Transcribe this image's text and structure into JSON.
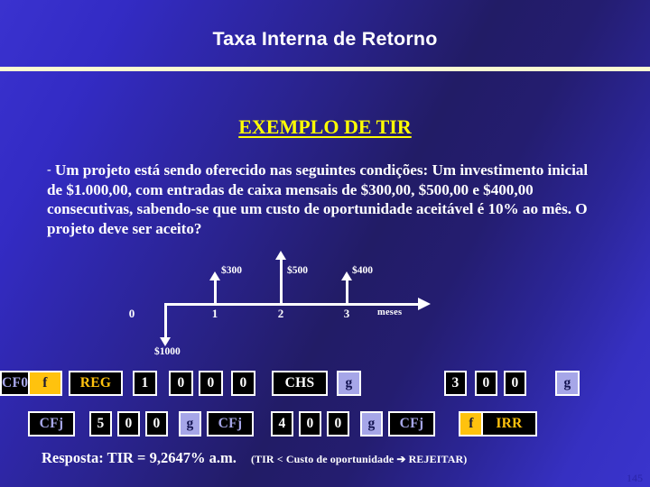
{
  "slide": {
    "title": "Taxa Interna de Retorno",
    "heading": "EXEMPLO DE TIR",
    "page_number": "145",
    "colors": {
      "background_light": "#3a34cd",
      "background_dark": "#221c66",
      "rule": "#fbfbd2",
      "heading": "#ffff00",
      "text": "#ffffff",
      "f_key_bg": "#ffc20e",
      "g_key_bg": "#a6a6e8",
      "key_bg": "#000000",
      "page_number": "#2a24a8"
    }
  },
  "problem": {
    "bullet": "-",
    "text": "Um projeto está sendo oferecido nas seguintes condições: Um investimento inicial de $1.000,00, com entradas de caixa mensais de $300,00, $500,00 e $400,00 consecutivas, sabendo-se que um custo de oportunidade aceitável é 10% ao mês. O projeto deve ser aceito?"
  },
  "timeline": {
    "axis_unit": "meses",
    "tick_labels": [
      "0",
      "1",
      "2",
      "3"
    ],
    "outflow": {
      "label": "$1000",
      "period": 0,
      "direction": "down",
      "amount": -1000
    },
    "inflows": [
      {
        "label": "$300",
        "period": 1,
        "direction": "up",
        "amount": 300
      },
      {
        "label": "$500",
        "period": 2,
        "direction": "up",
        "amount": 500
      },
      {
        "label": "$400",
        "period": 3,
        "direction": "up",
        "amount": 400
      }
    ]
  },
  "keypad": {
    "row1": [
      {
        "label": "f",
        "style": "f-key"
      },
      {
        "label": "REG",
        "style": "gold-text"
      },
      {
        "label": "1",
        "style": "plain"
      },
      {
        "label": "0",
        "style": "plain"
      },
      {
        "label": "0",
        "style": "plain"
      },
      {
        "label": "0",
        "style": "plain"
      },
      {
        "label": "CHS",
        "style": "plain"
      },
      {
        "label": "g",
        "style": "g-key"
      },
      {
        "label": "CF0",
        "style": "blue-text"
      },
      {
        "label": "3",
        "style": "plain"
      },
      {
        "label": "0",
        "style": "plain"
      },
      {
        "label": "0",
        "style": "plain"
      },
      {
        "label": "g",
        "style": "g-key"
      }
    ],
    "row2": [
      {
        "label": "CFj",
        "style": "blue-text"
      },
      {
        "label": "5",
        "style": "plain"
      },
      {
        "label": "0",
        "style": "plain"
      },
      {
        "label": "0",
        "style": "plain"
      },
      {
        "label": "g",
        "style": "g-key"
      },
      {
        "label": "CFj",
        "style": "blue-text"
      },
      {
        "label": "4",
        "style": "plain"
      },
      {
        "label": "0",
        "style": "plain"
      },
      {
        "label": "0",
        "style": "plain"
      },
      {
        "label": "g",
        "style": "g-key"
      },
      {
        "label": "CFj",
        "style": "blue-text"
      },
      {
        "label": "f",
        "style": "f-key"
      },
      {
        "label": "IRR",
        "style": "gold-text"
      }
    ]
  },
  "answer": {
    "main": "Resposta:  TIR = 9,2647% a.m.",
    "note": "(TIR < Custo de oportunidade ➔ REJEITAR)"
  }
}
